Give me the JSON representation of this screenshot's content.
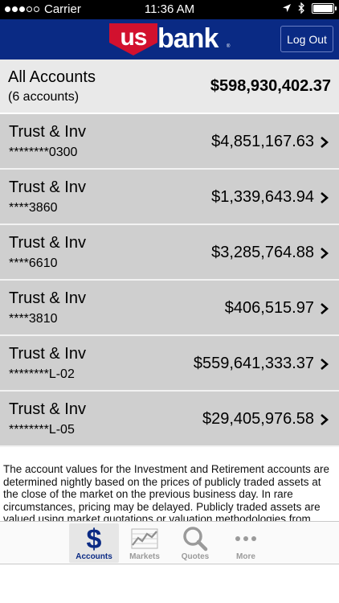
{
  "status_bar": {
    "carrier": "Carrier",
    "time": "11:36 AM",
    "battery_level": 1.0
  },
  "header": {
    "logo_text_us": "us",
    "logo_text_bank": "bank",
    "logo_reg": "®",
    "logout_label": "Log Out",
    "brand_color": "#0a2a84",
    "logo_red": "#d2112e"
  },
  "summary": {
    "title": "All Accounts",
    "count": "(6 accounts)",
    "total": "$598,930,402.37"
  },
  "accounts": [
    {
      "name": "Trust & Inv",
      "number": "********0300",
      "balance": "$4,851,167.63"
    },
    {
      "name": "Trust & Inv",
      "number": "****3860",
      "balance": "$1,339,643.94"
    },
    {
      "name": "Trust & Inv",
      "number": "****6610",
      "balance": "$3,285,764.88"
    },
    {
      "name": "Trust & Inv",
      "number": "****3810",
      "balance": "$406,515.97"
    },
    {
      "name": "Trust & Inv",
      "number": "********L-02",
      "balance": "$559,641,333.37"
    },
    {
      "name": "Trust & Inv",
      "number": "********L-05",
      "balance": "$29,405,976.58"
    }
  ],
  "disclaimer": "The account values for the Investment and Retirement accounts are determined nightly based on the prices of publicly traded assets at the close of the market on the previous business day. In rare circumstances, pricing may be delayed. Publicly traded assets are valued using market quotations or valuation methodologies from",
  "tabs": [
    {
      "label": "Accounts",
      "icon": "dollar-icon",
      "active": true
    },
    {
      "label": "Markets",
      "icon": "chart-icon",
      "active": false
    },
    {
      "label": "Quotes",
      "icon": "magnifier-icon",
      "active": false
    },
    {
      "label": "More",
      "icon": "ellipsis-icon",
      "active": false
    }
  ]
}
